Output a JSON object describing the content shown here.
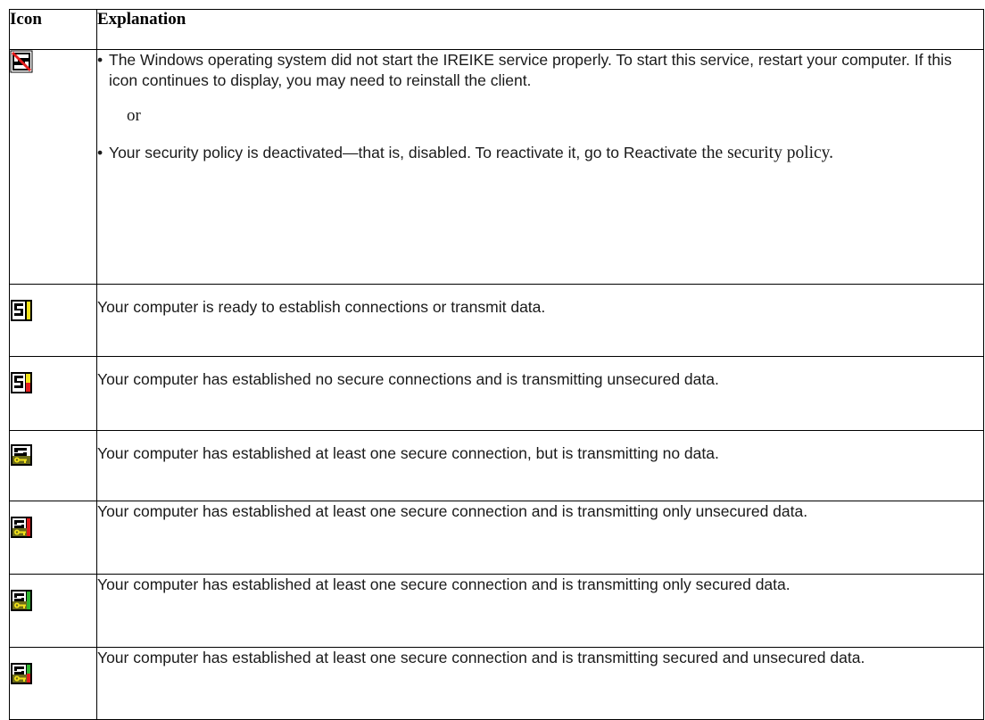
{
  "table": {
    "header_icon": "Icon",
    "header_explanation": "Explanation"
  },
  "rows": [
    {
      "icon": "disabled-s-icon",
      "bullet1": "The Windows operating system did not start the IREIKE service properly. To start this service, restart your computer. If this icon continues to display, you may need to reinstall the client.",
      "or": "or",
      "bullet2_sans": "Your security policy is deactivated—that is, disabled. To reactivate it, go to Reactivate",
      "bullet2_serif": "the security policy."
    },
    {
      "icon": "ready-s-icon",
      "text": "Your computer is ready to establish connections or transmit data."
    },
    {
      "icon": "unsecured-s-icon",
      "text": "Your computer has established no secure connections and is transmitting unsecured data."
    },
    {
      "icon": "key-idle-icon",
      "text": "Your computer has established at least one secure connection, but is transmitting no data."
    },
    {
      "icon": "key-unsecured-icon",
      "text": "Your computer has established at least one secure connection and is transmitting only unsecured data."
    },
    {
      "icon": "key-secured-icon",
      "text": "Your computer has established at least one secure connection and is transmitting only secured data."
    },
    {
      "icon": "key-mixed-icon",
      "text": "Your computer has established at least one secure connection and is transmitting secured and unsecured data."
    }
  ],
  "colors": {
    "red": "#e21b1b",
    "yellow": "#f2e21a",
    "green": "#2fb52f",
    "border": "#000000"
  }
}
